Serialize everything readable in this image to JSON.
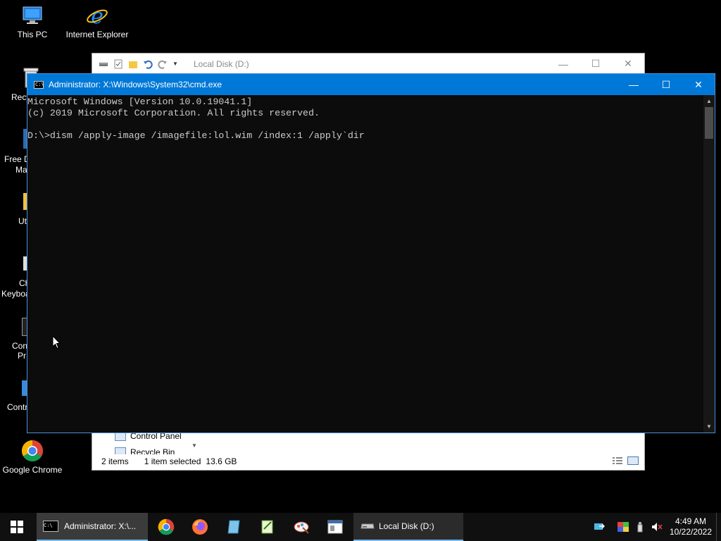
{
  "desktop": {
    "icons": [
      {
        "label": "This PC",
        "icon": "this-pc-icon"
      },
      {
        "label": "Internet Explorer",
        "icon": "internet-explorer-icon"
      },
      {
        "label": "Google Chrome",
        "icon": "chrome-icon"
      }
    ],
    "partial_labels": {
      "recycle": "Recy",
      "free_d1": "Free D",
      "free_d2": "Ma",
      "ut": "Ut",
      "ch1": "Ch",
      "ch2": "Keyboa",
      "con1": "Con",
      "con2": "Pr",
      "contr": "Contr"
    }
  },
  "explorer": {
    "title": "Local Disk (D:)",
    "nav_items": [
      "Control Panel",
      "Recycle Bin"
    ],
    "status": {
      "items": "2 items",
      "selected": "1 item selected",
      "size": "13.6 GB"
    }
  },
  "cmd": {
    "title": "Administrator: X:\\Windows\\System32\\cmd.exe",
    "lines": [
      "Microsoft Windows [Version 10.0.19041.1]",
      "(c) 2019 Microsoft Corporation. All rights reserved.",
      "",
      "D:\\>dism /apply-image /imagefile:lol.wim /index:1 /apply`dir"
    ]
  },
  "taskbar": {
    "tasks": [
      {
        "label": "Administrator: X:\\...",
        "icon": "cmd-icon"
      },
      {
        "label": "Local Disk (D:)",
        "icon": "drive-icon"
      }
    ],
    "pinned": [
      "chrome-icon",
      "firefox-icon",
      "notepad-icon",
      "sheet-icon",
      "paint-icon",
      "window-icon"
    ],
    "clock": {
      "time": "4:49 AM",
      "date": "10/22/2022"
    }
  }
}
